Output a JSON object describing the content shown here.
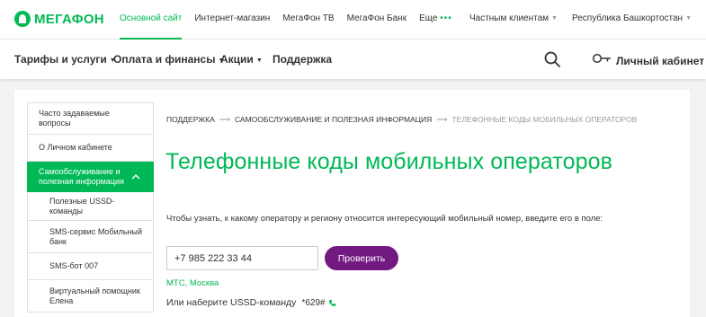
{
  "brand": {
    "name": "МегаФон",
    "accent": "#00b956",
    "purple": "#731982"
  },
  "top_links": [
    {
      "label": "Основной сайт",
      "active": true
    },
    {
      "label": "Интернет-магазин"
    },
    {
      "label": "МегаФон ТВ"
    },
    {
      "label": "МегаФон Банк"
    },
    {
      "label": "Еще"
    }
  ],
  "top_right": {
    "segment": "Частным клиентам",
    "region": "Республика Башкортостан"
  },
  "main_nav": {
    "tariffs": "Тарифы и услуги",
    "payment": "Оплата и финансы",
    "promos": "Акции",
    "support": "Поддержка",
    "cabinet": "Личный кабинет",
    "search_icon": "search-icon",
    "key_icon": "key-icon"
  },
  "sidebar": {
    "items": [
      {
        "label": "Часто задаваемые вопросы"
      },
      {
        "label": "О Личном кабинете"
      },
      {
        "label": "Самообслуживание и полезная информация",
        "active": true
      },
      {
        "label": "Полезные USSD-команды",
        "sub": true
      },
      {
        "label": "SMS-сервис Мобильный банк",
        "sub": true
      },
      {
        "label": "SMS-бот 007",
        "sub": true
      },
      {
        "label": "Виртуальный помощник Елена",
        "sub": true
      }
    ]
  },
  "breadcrumb": {
    "level1": "ПОДДЕРЖКА",
    "level2": "САМООБСЛУЖИВАНИЕ И ПОЛЕЗНАЯ ИНФОРМАЦИЯ",
    "current": "ТЕЛЕФОННЫЕ КОДЫ МОБИЛЬНЫХ ОПЕРАТОРОВ"
  },
  "page": {
    "title": "Телефонные коды мобильных операторов",
    "description": "Чтобы узнать, к какому оператору и региону относится интересующий мобильный номер, введите его в поле:",
    "phone_value": "+7 985 222 33 44",
    "check_label": "Проверить",
    "result": "МТС, Москва",
    "ussd_label": "Или наберите USSD-команду",
    "ussd_code": "*629#"
  }
}
